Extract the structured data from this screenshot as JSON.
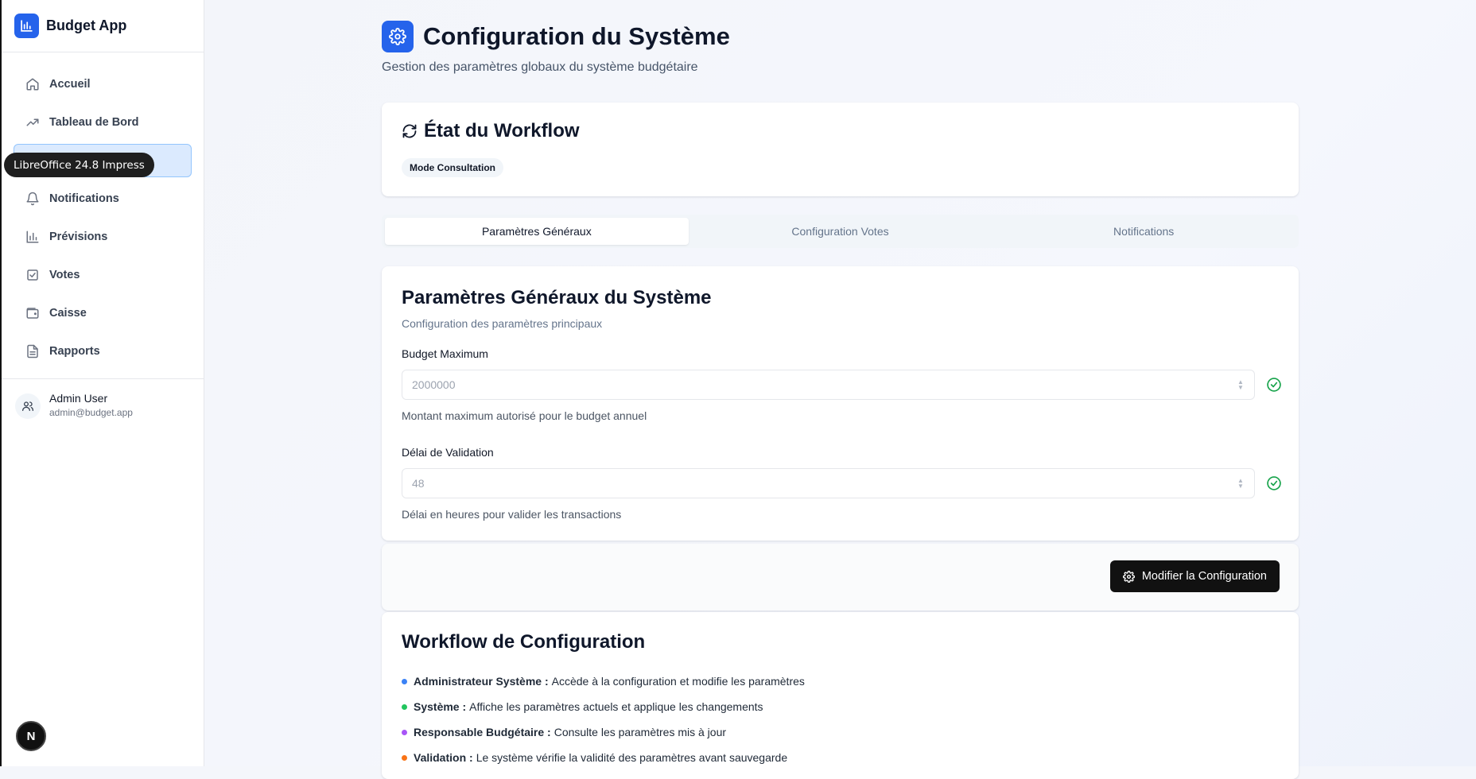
{
  "app": {
    "name": "Budget App"
  },
  "sidebar": {
    "items": [
      {
        "label": "Accueil",
        "icon": "home-icon"
      },
      {
        "label": "Tableau de Bord",
        "icon": "trending-up-icon"
      },
      {
        "label": "",
        "icon": "settings-icon",
        "active": true
      },
      {
        "label": "Notifications",
        "icon": "bell-icon"
      },
      {
        "label": "Prévisions",
        "icon": "bar-chart-icon"
      },
      {
        "label": "Votes",
        "icon": "vote-icon"
      },
      {
        "label": "Caisse",
        "icon": "wallet-icon"
      },
      {
        "label": "Rapports",
        "icon": "file-text-icon"
      }
    ],
    "user": {
      "name": "Admin User",
      "email": "admin@budget.app"
    }
  },
  "tooltip": {
    "text": "LibreOffice 24.8 Impress"
  },
  "next_badge": {
    "label": "N"
  },
  "page": {
    "title": "Configuration du Système",
    "subtitle": "Gestion des paramètres globaux du système budgétaire"
  },
  "workflow_state": {
    "title": "État du Workflow",
    "badge": "Mode Consultation"
  },
  "tabs": [
    {
      "label": "Paramètres Généraux",
      "active": true
    },
    {
      "label": "Configuration Votes",
      "active": false
    },
    {
      "label": "Notifications",
      "active": false
    }
  ],
  "general": {
    "title": "Paramètres Généraux du Système",
    "subtitle": "Configuration des paramètres principaux",
    "fields": [
      {
        "label": "Budget Maximum",
        "value": "2000000",
        "help": "Montant maximum autorisé pour le budget annuel"
      },
      {
        "label": "Délai de Validation",
        "value": "48",
        "help": "Délai en heures pour valider les transactions"
      }
    ],
    "button": "Modifier la Configuration"
  },
  "flow": {
    "title": "Workflow de Configuration",
    "items": [
      {
        "role": "Administrateur Système :",
        "text": "Accède à la configuration et modifie les paramètres",
        "color": "#3b82f6"
      },
      {
        "role": "Système :",
        "text": "Affiche les paramètres actuels et applique les changements",
        "color": "#22c55e"
      },
      {
        "role": "Responsable Budgétaire :",
        "text": "Consulte les paramètres mis à jour",
        "color": "#a855f7"
      },
      {
        "role": "Validation :",
        "text": "Le système vérifie la validité des paramètres avant sauvegarde",
        "color": "#f97316"
      }
    ]
  },
  "colors": {
    "accent": "#2563eb",
    "success": "#16a34a",
    "dark_button": "#111111"
  }
}
